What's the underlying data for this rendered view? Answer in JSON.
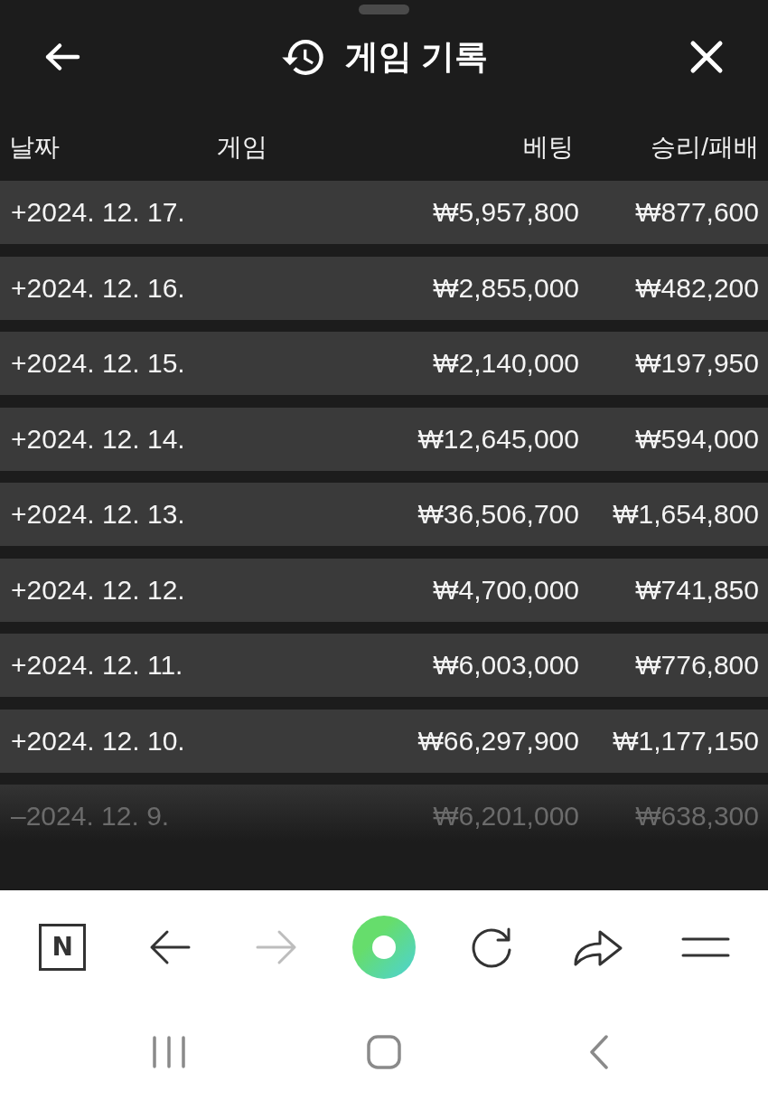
{
  "header": {
    "title": "게임 기록"
  },
  "table": {
    "columns": [
      "날짜",
      "게임",
      "베팅",
      "승리/패배"
    ],
    "rows": [
      {
        "date": "+2024. 12. 17.",
        "bet": "₩5,957,800",
        "result": "₩877,600",
        "faded": false
      },
      {
        "date": "+2024. 12. 16.",
        "bet": "₩2,855,000",
        "result": "₩482,200",
        "faded": false
      },
      {
        "date": "+2024. 12. 15.",
        "bet": "₩2,140,000",
        "result": "₩197,950",
        "faded": false
      },
      {
        "date": "+2024. 12. 14.",
        "bet": "₩12,645,000",
        "result": "₩594,000",
        "faded": false
      },
      {
        "date": "+2024. 12. 13.",
        "bet": "₩36,506,700",
        "result": "₩1,654,800",
        "faded": false
      },
      {
        "date": "+2024. 12. 12.",
        "bet": "₩4,700,000",
        "result": "₩741,850",
        "faded": false
      },
      {
        "date": "+2024. 12. 11.",
        "bet": "₩6,003,000",
        "result": "₩776,800",
        "faded": false
      },
      {
        "date": "+2024. 12. 10.",
        "bet": "₩66,297,900",
        "result": "₩1,177,150",
        "faded": false
      },
      {
        "date": "–2024. 12. 9.",
        "bet": "₩6,201,000",
        "result": "₩638,300",
        "faded": true
      }
    ]
  },
  "browser_toolbar": {
    "buttons": [
      {
        "kind": "logo",
        "label": "N",
        "disabled": false
      },
      {
        "kind": "back",
        "disabled": false
      },
      {
        "kind": "forward",
        "disabled": true
      },
      {
        "kind": "ring",
        "disabled": false
      },
      {
        "kind": "reload",
        "disabled": false
      },
      {
        "kind": "share",
        "disabled": false
      },
      {
        "kind": "menu",
        "disabled": false
      }
    ]
  },
  "system_nav": {
    "buttons": [
      {
        "kind": "recent"
      },
      {
        "kind": "home"
      },
      {
        "kind": "back"
      }
    ]
  }
}
